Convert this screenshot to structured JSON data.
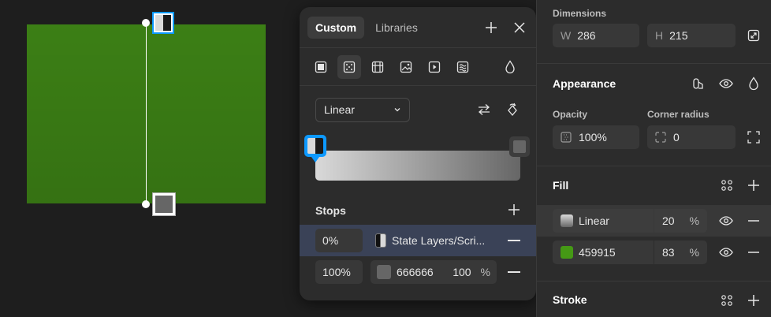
{
  "popover": {
    "tabs": [
      "Custom",
      "Libraries"
    ],
    "gradient_type": "Linear",
    "stops_title": "Stops",
    "stops": [
      {
        "position": "0%",
        "name": "State Layers/Scri...",
        "color": "#d9d9d9"
      },
      {
        "position": "100%",
        "name": "666666",
        "opacity": "100",
        "unit": "%",
        "color": "#666666"
      }
    ]
  },
  "panel": {
    "dimensions_label": "Dimensions",
    "w_label": "W",
    "w_value": "286",
    "h_label": "H",
    "h_value": "215",
    "appearance_title": "Appearance",
    "opacity_label": "Opacity",
    "opacity_value": "100%",
    "corner_label": "Corner radius",
    "corner_value": "0",
    "fill_title": "Fill",
    "fills": [
      {
        "name": "Linear",
        "opacity": "20",
        "unit": "%"
      },
      {
        "name": "459915",
        "opacity": "83",
        "unit": "%",
        "color": "#459915"
      }
    ],
    "stroke_title": "Stroke"
  },
  "colors": {
    "accent": "#0d99ff",
    "fill_green": "#459915",
    "stop_gray": "#666666",
    "stop_light": "#d9d9d9"
  }
}
